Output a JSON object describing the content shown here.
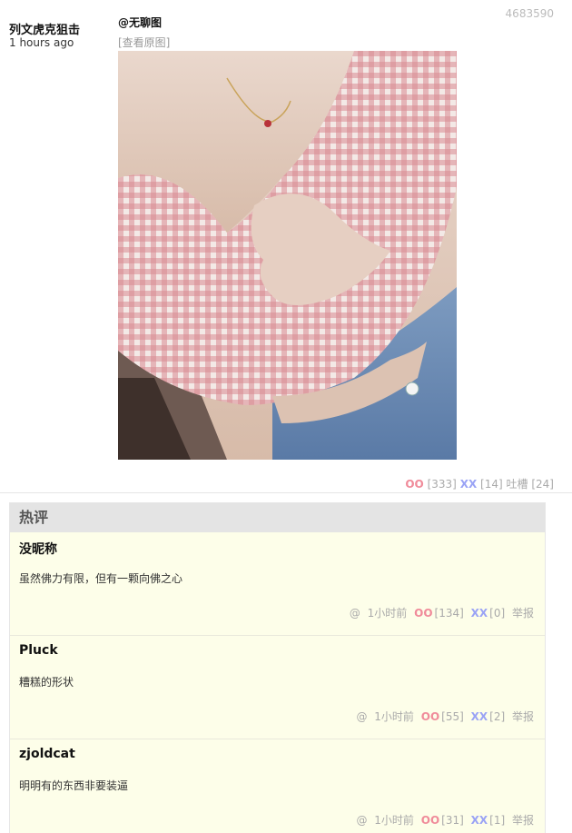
{
  "post": {
    "author": "列文虎克狙击",
    "time": "1 hours ago",
    "id": "4683590",
    "mention": "@无聊图",
    "view_original": "[查看原图]",
    "photo_icon": "photo-image",
    "votes": {
      "oo_label": "OO",
      "oo_count": "[333]",
      "xx_label": "XX",
      "xx_count": "[14]",
      "tucao_label": "吐槽",
      "tucao_count": "[24]"
    }
  },
  "hot": {
    "title": "热评",
    "comments": [
      {
        "name": "没昵称",
        "text": "虽然佛力有限，但有一颗向佛之心",
        "at": "@",
        "time": "1小时前",
        "oo": "OO",
        "oo_count": "[134]",
        "xx": "XX",
        "xx_count": "[0]",
        "report": "举报"
      },
      {
        "name": "Pluck",
        "text": "糟糕的形状",
        "at": "@",
        "time": "1小时前",
        "oo": "OO",
        "oo_count": "[55]",
        "xx": "XX",
        "xx_count": "[2]",
        "report": "举报"
      },
      {
        "name": "zjoldcat",
        "text": "明明有的东西非要装逼",
        "at": "@",
        "time": "1小时前",
        "oo": "OO",
        "oo_count": "[31]",
        "xx": "XX",
        "xx_count": "[1]",
        "report": "举报"
      }
    ]
  },
  "colors": {
    "oo": "#f08b9a",
    "xx": "#9aa3f5",
    "hot_bg": "#fdfee9",
    "hot_header_bg": "#e4e4e4"
  }
}
